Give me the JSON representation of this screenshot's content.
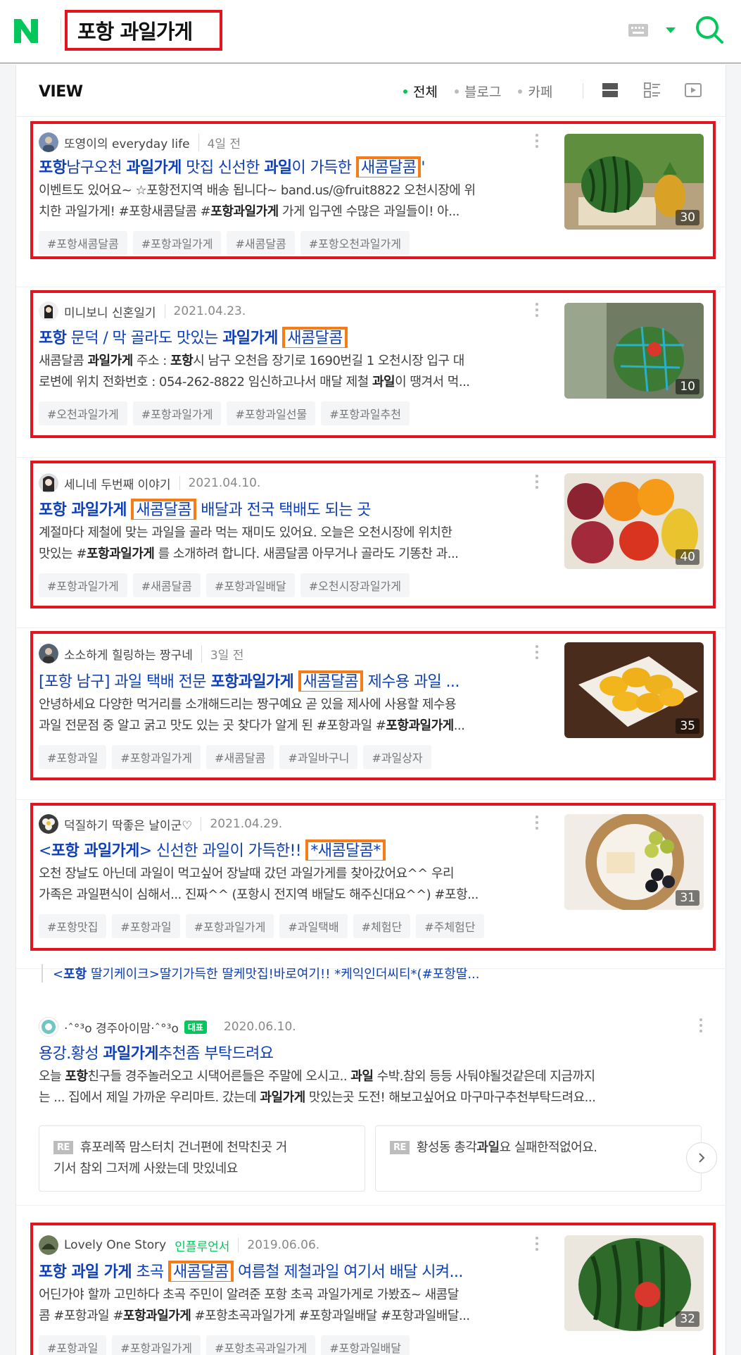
{
  "search": {
    "query": "포항 과일가게"
  },
  "view": {
    "title": "VIEW",
    "filters": [
      {
        "label": "전체"
      },
      {
        "label": "블로그"
      },
      {
        "label": "카페"
      }
    ]
  },
  "results": [
    {
      "author": "또영이의 everyday life",
      "date": "4일 전",
      "title": {
        "a": "포항",
        "b": "남구오천 ",
        "c": "과일가게",
        "d": " 맛집 신선한 ",
        "e": "과일",
        "f": "이 가득한 ",
        "g": "새콤달콤",
        "h": "'"
      },
      "desc": {
        "l1": "이벤트도 있어요~ ☆포항전지역 배송 됩니다~ band.us/@fruit8822 오천시장에 위",
        "l2a": "치한 과일가게! #포항새콤달콤 #",
        "l2b": "포항과일가게",
        "l2c": " 가게 입구엔 수많은 과일들이! 아..."
      },
      "tags": [
        "#포항새콤달콤",
        "#포항과일가게",
        "#새콤달콤",
        "#포항오천과일가게"
      ],
      "count": "30"
    },
    {
      "author": "미니보니 신혼일기",
      "date": "2021.04.23.",
      "title": {
        "a": "포항",
        "b": " 문덕 / 막 골라도 맛있는 ",
        "c": "과일가게",
        "g": "새콤달콤"
      },
      "desc": {
        "l1a": "새콤달콤 ",
        "l1b": "과일가게",
        "l1c": " 주소 : ",
        "l1d": "포항",
        "l1e": "시 남구 오천읍 장기로 1690번길 1 오천시장 입구 대",
        "l2a": "로변에 위치 전화번호 : 054-262-8822 임신하고나서 매달 제철 ",
        "l2b": "과일",
        "l2c": "이 땡겨서 먹..."
      },
      "tags": [
        "#오천과일가게",
        "#포항과일가게",
        "#포항과일선물",
        "#포항과일추천"
      ],
      "count": "10"
    },
    {
      "author": "세니네 두번째 이야기",
      "date": "2021.04.10.",
      "title": {
        "a": "포항 과일가게",
        "g": "새콤달콤",
        "h": " 배달과 전국 택배도 되는 곳"
      },
      "desc": {
        "l1": "계절마다 제철에 맞는 과일을 골라 먹는 재미도 있어요. 오늘은 오천시장에 위치한",
        "l2a": "맛있는 #",
        "l2b": "포항과일가게",
        "l2c": " 를 소개하려 합니다. 새콤달콤 아무거나 골라도 기똥찬 과..."
      },
      "tags": [
        "#포항과일가게",
        "#새콤달콤",
        "#포항과일배달",
        "#오천시장과일가게"
      ],
      "count": "40"
    },
    {
      "author": "소소하게 힐링하는 짱구네",
      "date": "3일 전",
      "title": {
        "a": "[포항 남구] 과일 택배 전문 ",
        "b": "포항과일가게",
        "g": "새콤달콤",
        "h": " 제수용 과일 ..."
      },
      "desc": {
        "l1": "안녕하세요 다양한 먹거리를 소개해드리는 짱구예요 곧 있을 제사에 사용할 제수용",
        "l2a": "과일 전문점 중 알고 굵고 맛도 있는 곳 찾다가 알게 된 #포항과일 #",
        "l2b": "포항과일가게",
        "l2c": "..."
      },
      "tags": [
        "#포항과일",
        "#포항과일가게",
        "#새콤달콤",
        "#과일바구니",
        "#과일상자"
      ],
      "count": "35"
    },
    {
      "author": "덕질하기 딱좋은 날이군♡",
      "date": "2021.04.29.",
      "title": {
        "a": "<",
        "b": "포항 과일가게",
        "c": "> 신선한 과일이 가득한!! ",
        "g": "*새콤달콤*"
      },
      "desc": {
        "l1": "오천 장날도 아닌데 과일이 먹고싶어 장날때 갔던 과일가게를 찾아갔어요^^ 우리",
        "l2": "가족은 과일편식이 심해서... 진짜^^ (포항시 전지역 배달도 해주신대요^^) #포항..."
      },
      "tags": [
        "#포항맛집",
        "#포항과일",
        "#포항과일가게",
        "#과일택배",
        "#체험단",
        "#주체험단"
      ],
      "count": "31"
    }
  ],
  "extra_link": {
    "a": "<",
    "b": "포항",
    "c": " 딸기케이크>딸기가득한 딸케맛집!바로여기!! *케익인더씨티*(#포항딸..."
  },
  "cafe_post": {
    "author": "·ˆ°³ο 경주아이맘·ˆ°³ο",
    "badge": "대표",
    "date": "2020.06.10.",
    "title": {
      "a": "용강.황성 ",
      "b": "과일가게",
      "c": "추천좀 부탁드려요"
    },
    "desc": {
      "l1a": "오늘 ",
      "l1b": "포항",
      "l1c": "친구들 경주놀러오고 시댁어른들은 주말에 오시고.. ",
      "l1d": "과일",
      "l1e": " 수박.참외 등등 사둬야될것같은데 지금까지",
      "l2a": "는 ... 집에서 제일 가까운 우리마트. 갔는데 ",
      "l2b": "과일가게",
      "l2c": " 맛있는곳 도전! 해보고싶어요 마구마구추천부탁드려요..."
    },
    "comments": [
      {
        "re": "RE",
        "l1": "휴포레쪽 맘스터치 건너편에 천막친곳 거",
        "l2": "기서 참외 그저께 사왔는데 맛있네요"
      },
      {
        "re": "RE",
        "a": "황성동 총각",
        "b": "과일",
        "c": "요 실패한적없어요."
      }
    ]
  },
  "last_result": {
    "author": "Lovely One Story",
    "influencer": "인플루언서",
    "date": "2019.06.06.",
    "title": {
      "a": "포항 과일 가게",
      "b": " 초곡 ",
      "g": "새콤달콤",
      "h": " 여름철 제철과일 여기서 배달 시켜..."
    },
    "desc": {
      "l1": "어딘가야 할까 고민하다 초곡 주민이 알려준 포항 초곡 과일가게로 가봤죠~ 새콤달",
      "l2a": "콤 #포항과일 #",
      "l2b": "포항과일가게",
      "l2c": " #포항초곡과일가게 #포항과일배달 #포항과일배달..."
    },
    "tags": [
      "#포항과일",
      "#포항과일가게",
      "#포항초곡과일가게",
      "#포항과일배달"
    ],
    "count": "32"
  },
  "colors": {
    "naver_green": "#03c75a",
    "link_blue": "#0f3fb6",
    "highlight_red": "#e4141e",
    "highlight_orange": "#f57c17"
  }
}
